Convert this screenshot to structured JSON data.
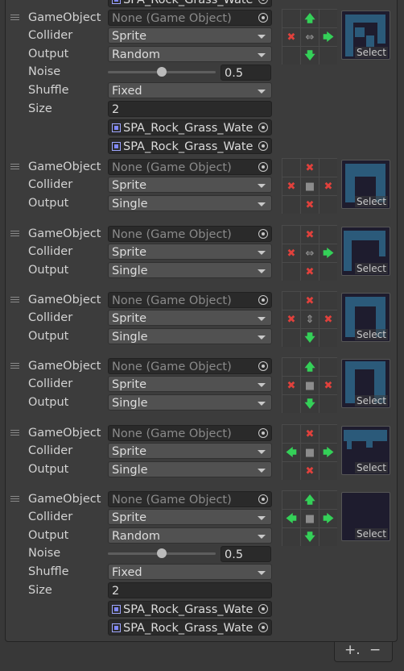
{
  "labels": {
    "gameobject": "GameObject",
    "collider": "Collider",
    "output": "Output",
    "noise": "Noise",
    "shuffle": "Shuffle",
    "size": "Size",
    "select": "Select"
  },
  "rules": [
    {
      "gameobject": "None (Game Object)",
      "collider": "Sprite",
      "output": "Random",
      "noise": "0.5",
      "noise_fraction": 0.5,
      "shuffle": "Fixed",
      "size": "2",
      "sprites": [
        "SPA_Rock_Grass_Wate",
        "SPA_Rock_Grass_Wate"
      ],
      "neighbors": [
        "",
        "up-arrow",
        "",
        "x",
        "left-right",
        "right-arrow",
        "",
        "down-arrow",
        ""
      ]
    },
    {
      "gameobject": "None (Game Object)",
      "collider": "Sprite",
      "output": "Single",
      "neighbors": [
        "",
        "x",
        "",
        "x",
        "center",
        "x",
        "",
        "x",
        ""
      ]
    },
    {
      "gameobject": "None (Game Object)",
      "collider": "Sprite",
      "output": "Single",
      "neighbors": [
        "",
        "x",
        "",
        "x",
        "left-right",
        "right-arrow",
        "",
        "x",
        ""
      ]
    },
    {
      "gameobject": "None (Game Object)",
      "collider": "Sprite",
      "output": "Single",
      "neighbors": [
        "",
        "x",
        "",
        "x",
        "up-down",
        "x",
        "",
        "down-arrow",
        ""
      ]
    },
    {
      "gameobject": "None (Game Object)",
      "collider": "Sprite",
      "output": "Single",
      "neighbors": [
        "",
        "up-arrow",
        "",
        "x",
        "center",
        "x",
        "",
        "down-arrow",
        ""
      ]
    },
    {
      "gameobject": "None (Game Object)",
      "collider": "Sprite",
      "output": "Single",
      "neighbors": [
        "",
        "x",
        "",
        "left-arrow",
        "center",
        "right-arrow",
        "",
        "x",
        ""
      ]
    },
    {
      "gameobject": "None (Game Object)",
      "collider": "Sprite",
      "output": "Random",
      "noise": "0.5",
      "noise_fraction": 0.5,
      "shuffle": "Fixed",
      "size": "2",
      "sprites": [
        "SPA_Rock_Grass_Wate",
        "SPA_Rock_Grass_Wate"
      ],
      "neighbors": [
        "",
        "up-arrow",
        "",
        "left-arrow",
        "center",
        "right-arrow",
        "",
        "down-arrow",
        ""
      ]
    }
  ],
  "top_clip_sprite": "SPA_Rock_Grass_Wate",
  "footer": {
    "add": "+.",
    "remove": "−"
  }
}
